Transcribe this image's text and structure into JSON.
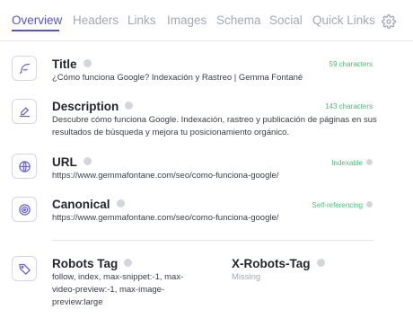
{
  "tabs": [
    {
      "label": "Overview",
      "active": true
    },
    {
      "label": "Headers",
      "active": false
    },
    {
      "label": "Links",
      "active": false
    },
    {
      "label": "Images",
      "active": false
    },
    {
      "label": "Schema",
      "active": false
    },
    {
      "label": "Social",
      "active": false
    },
    {
      "label": "Quick Links",
      "active": false
    }
  ],
  "fields": {
    "title": {
      "label": "Title",
      "meta": "59 characters",
      "value": "¿Cómo funciona Google? Indexación y Rastreo | Gemma Fontané",
      "icon": "feather-icon"
    },
    "description": {
      "label": "Description",
      "meta": "143 characters",
      "value": "Descubre cómo funciona Google. Indexación, rastreo y publicación de páginas en sus resultados de búsqueda y mejora tu posicionamiento orgánico.",
      "icon": "edit-icon"
    },
    "url": {
      "label": "URL",
      "meta": "Indexable",
      "value": "https://www.gemmafontane.com/seo/como-funciona-google/",
      "icon": "globe-icon"
    },
    "canonical": {
      "label": "Canonical",
      "meta": "Self-referencing",
      "value": "https://www.gemmafontane.com/seo/como-funciona-google/",
      "icon": "target-icon"
    },
    "robots": {
      "label": "Robots Tag",
      "value": "follow, index, max-snippet:-1, max-video-preview:-1, max-image-preview:large",
      "icon": "tag-icon"
    },
    "x_robots": {
      "label": "X-Robots-Tag",
      "value": "Missing"
    }
  },
  "colors": {
    "accent": "#5b54c9",
    "meta_green": "#55b97a",
    "muted": "#a3a7b6"
  }
}
